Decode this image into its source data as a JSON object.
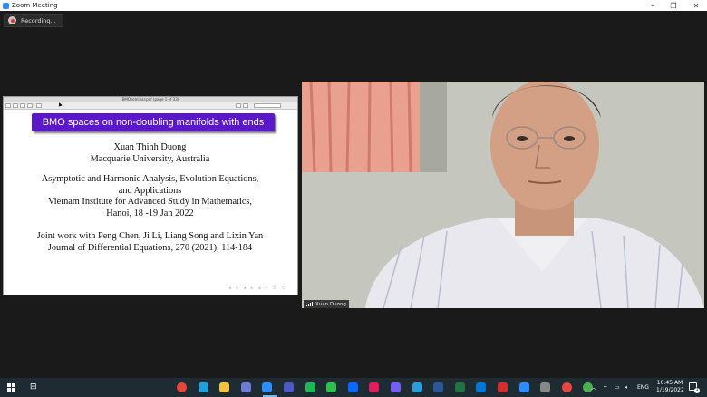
{
  "window": {
    "title": "Zoom Meeting"
  },
  "recording": {
    "label": "Recording..."
  },
  "pdf_viewer": {
    "title_bar": "BMOseminar.pdf (page 1 of 33)"
  },
  "slide": {
    "title": "BMO spaces on non-doubling manifolds with ends",
    "author": "Xuan Thinh Duong",
    "affiliation": "Macquarie University,  Australia",
    "event_line1": "Asymptotic and Harmonic Analysis, Evolution Equations,",
    "event_line2": "and Applications",
    "event_line3": "Vietnam Institute for Advanced Study in Mathematics,",
    "event_line4": "Hanoi, 18 -19 Jan 2022",
    "joint_line1": "Joint work with Peng Chen, Ji Li, Liang Song and Lixin Yan",
    "joint_line2": "Journal of Differential Equations, 270 (2021), 114-184"
  },
  "participant": {
    "name": "Xuan Duong"
  },
  "taskbar": {
    "language": "ENG",
    "time": "10:45 AM",
    "date": "1/19/2022",
    "notification_count": "1",
    "apps": [
      {
        "name": "chrome",
        "color": "#e8453c"
      },
      {
        "name": "edge",
        "color": "#1fa0dd"
      },
      {
        "name": "file-explorer",
        "color": "#f3c33f"
      },
      {
        "name": "store",
        "color": "#6b7bd6"
      },
      {
        "name": "zoom",
        "color": "#2d8cff"
      },
      {
        "name": "teams",
        "color": "#5059c9"
      },
      {
        "name": "spotify",
        "color": "#1db954"
      },
      {
        "name": "facetime",
        "color": "#2fbf4e"
      },
      {
        "name": "zalo",
        "color": "#0a68ff"
      },
      {
        "name": "slack",
        "color": "#e01e5a"
      },
      {
        "name": "viber",
        "color": "#7360f2"
      },
      {
        "name": "app-c",
        "color": "#2c9cdb"
      },
      {
        "name": "word",
        "color": "#2b579a"
      },
      {
        "name": "excel",
        "color": "#217346"
      },
      {
        "name": "outlook",
        "color": "#0078d4"
      },
      {
        "name": "acrobat",
        "color": "#d32f2f"
      },
      {
        "name": "zoom-2",
        "color": "#2d8cff"
      },
      {
        "name": "app-globe",
        "color": "#888888"
      },
      {
        "name": "chrome-2",
        "color": "#e8453c"
      },
      {
        "name": "chrome-3",
        "color": "#4caf50"
      }
    ]
  }
}
